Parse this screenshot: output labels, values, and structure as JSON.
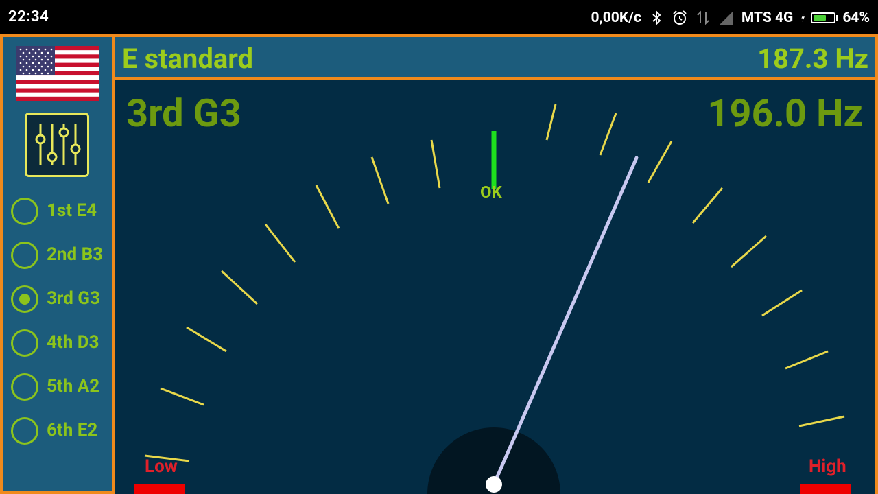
{
  "status_bar": {
    "time": "22:34",
    "speed": "0,00K/c",
    "carrier": "MTS 4G",
    "battery": "64%",
    "icons": [
      "bluetooth-icon",
      "alarm-icon",
      "data-transfer-icon",
      "signal-icon",
      "charging-icon",
      "battery-icon"
    ]
  },
  "header": {
    "tuning_name": "E standard",
    "detected_frequency": "187.3 Hz"
  },
  "sidebar": {
    "flag": "us-flag",
    "settings_icon": "equalizer-sliders-icon",
    "strings": [
      {
        "label": "1st E4",
        "selected": false
      },
      {
        "label": "2nd B3",
        "selected": false
      },
      {
        "label": "3rd G3",
        "selected": true
      },
      {
        "label": "4th D3",
        "selected": false
      },
      {
        "label": "5th A2",
        "selected": false
      },
      {
        "label": "6th E2",
        "selected": false
      }
    ]
  },
  "gauge": {
    "note": "3rd G3",
    "target_frequency": "196.0 Hz",
    "ok_label": "OK",
    "low_label": "Low",
    "high_label": "High",
    "colors": {
      "tick": "#e8d84a",
      "center_tick": "#1ee01e",
      "needle": "#c8c8f0",
      "low_high_bar": "#ee0000"
    }
  }
}
